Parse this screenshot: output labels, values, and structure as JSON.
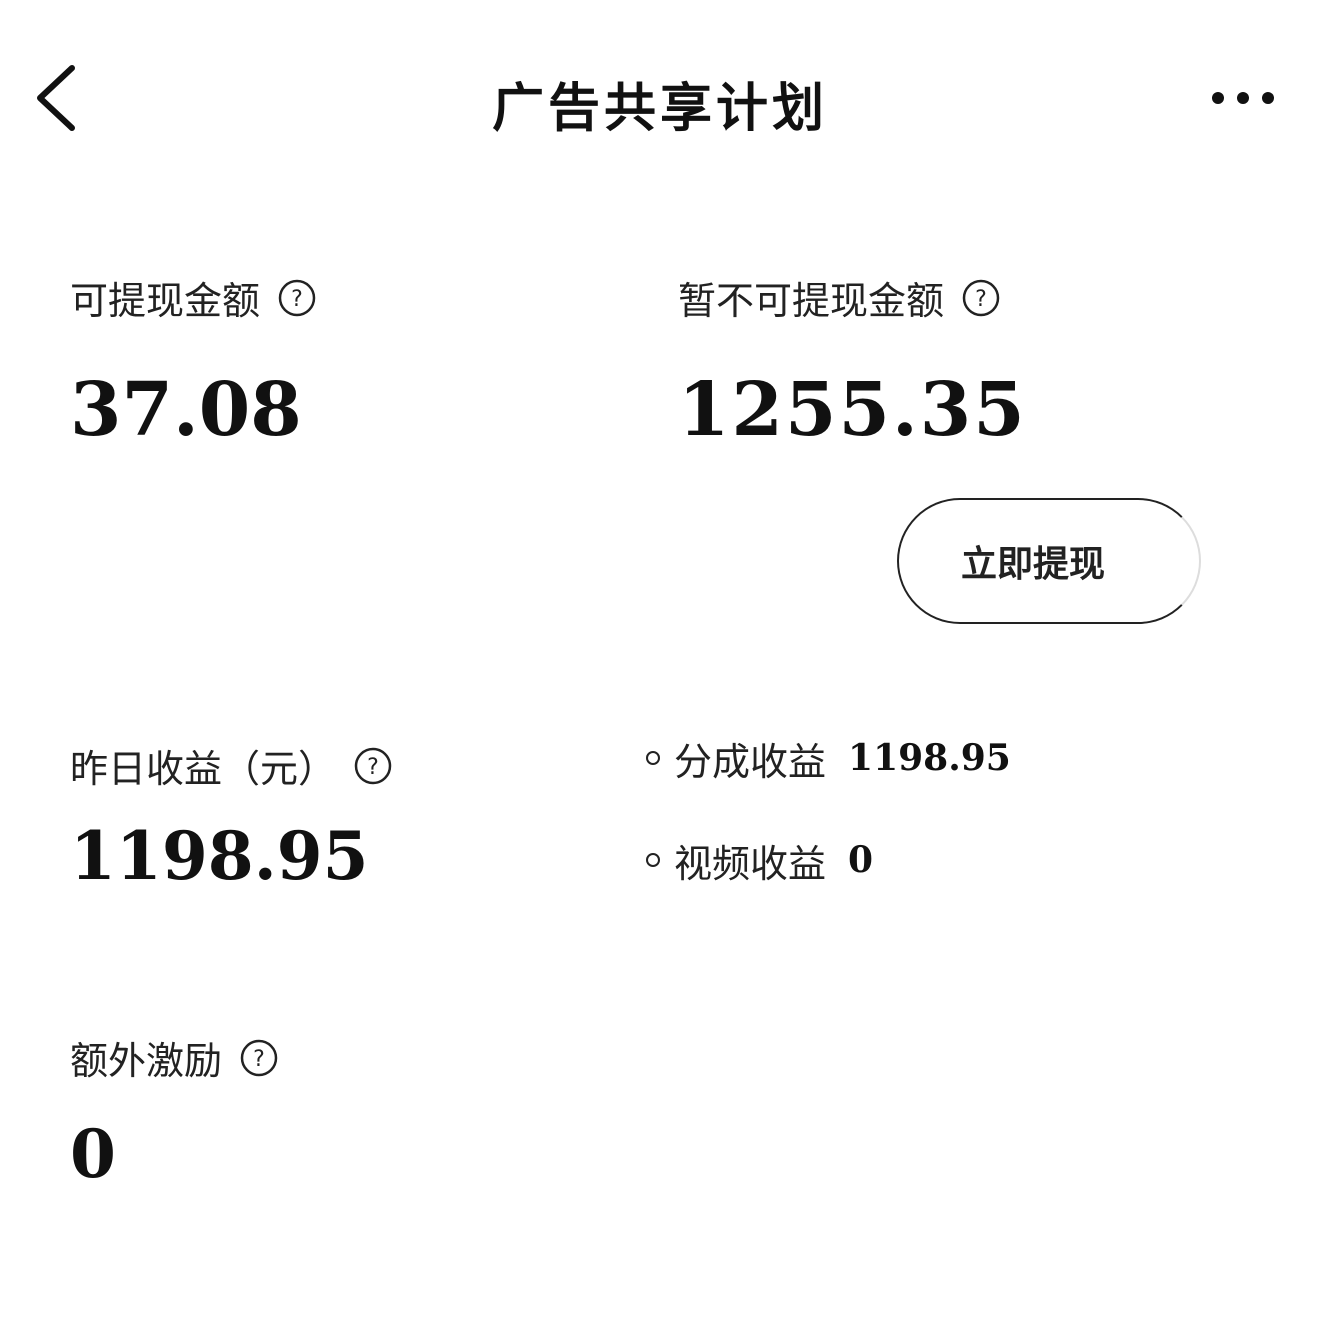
{
  "header": {
    "title": "广告共享计划",
    "back_icon": "chevron-left-icon",
    "more_icon": "more-horizontal-icon"
  },
  "balances": {
    "withdrawable": {
      "label": "可提现金额",
      "value": "37.08"
    },
    "pending": {
      "label": "暂不可提现金额",
      "value": "1255.35"
    },
    "withdraw_button": "立即提现"
  },
  "yesterday": {
    "label": "昨日收益（元）",
    "value": "1198.95",
    "breakdown": [
      {
        "label": "分成收益",
        "value": "1198.95"
      },
      {
        "label": "视频收益",
        "value": "0"
      }
    ]
  },
  "extra": {
    "label": "额外激励",
    "value": "0"
  },
  "help_icon": "question-circle-icon"
}
